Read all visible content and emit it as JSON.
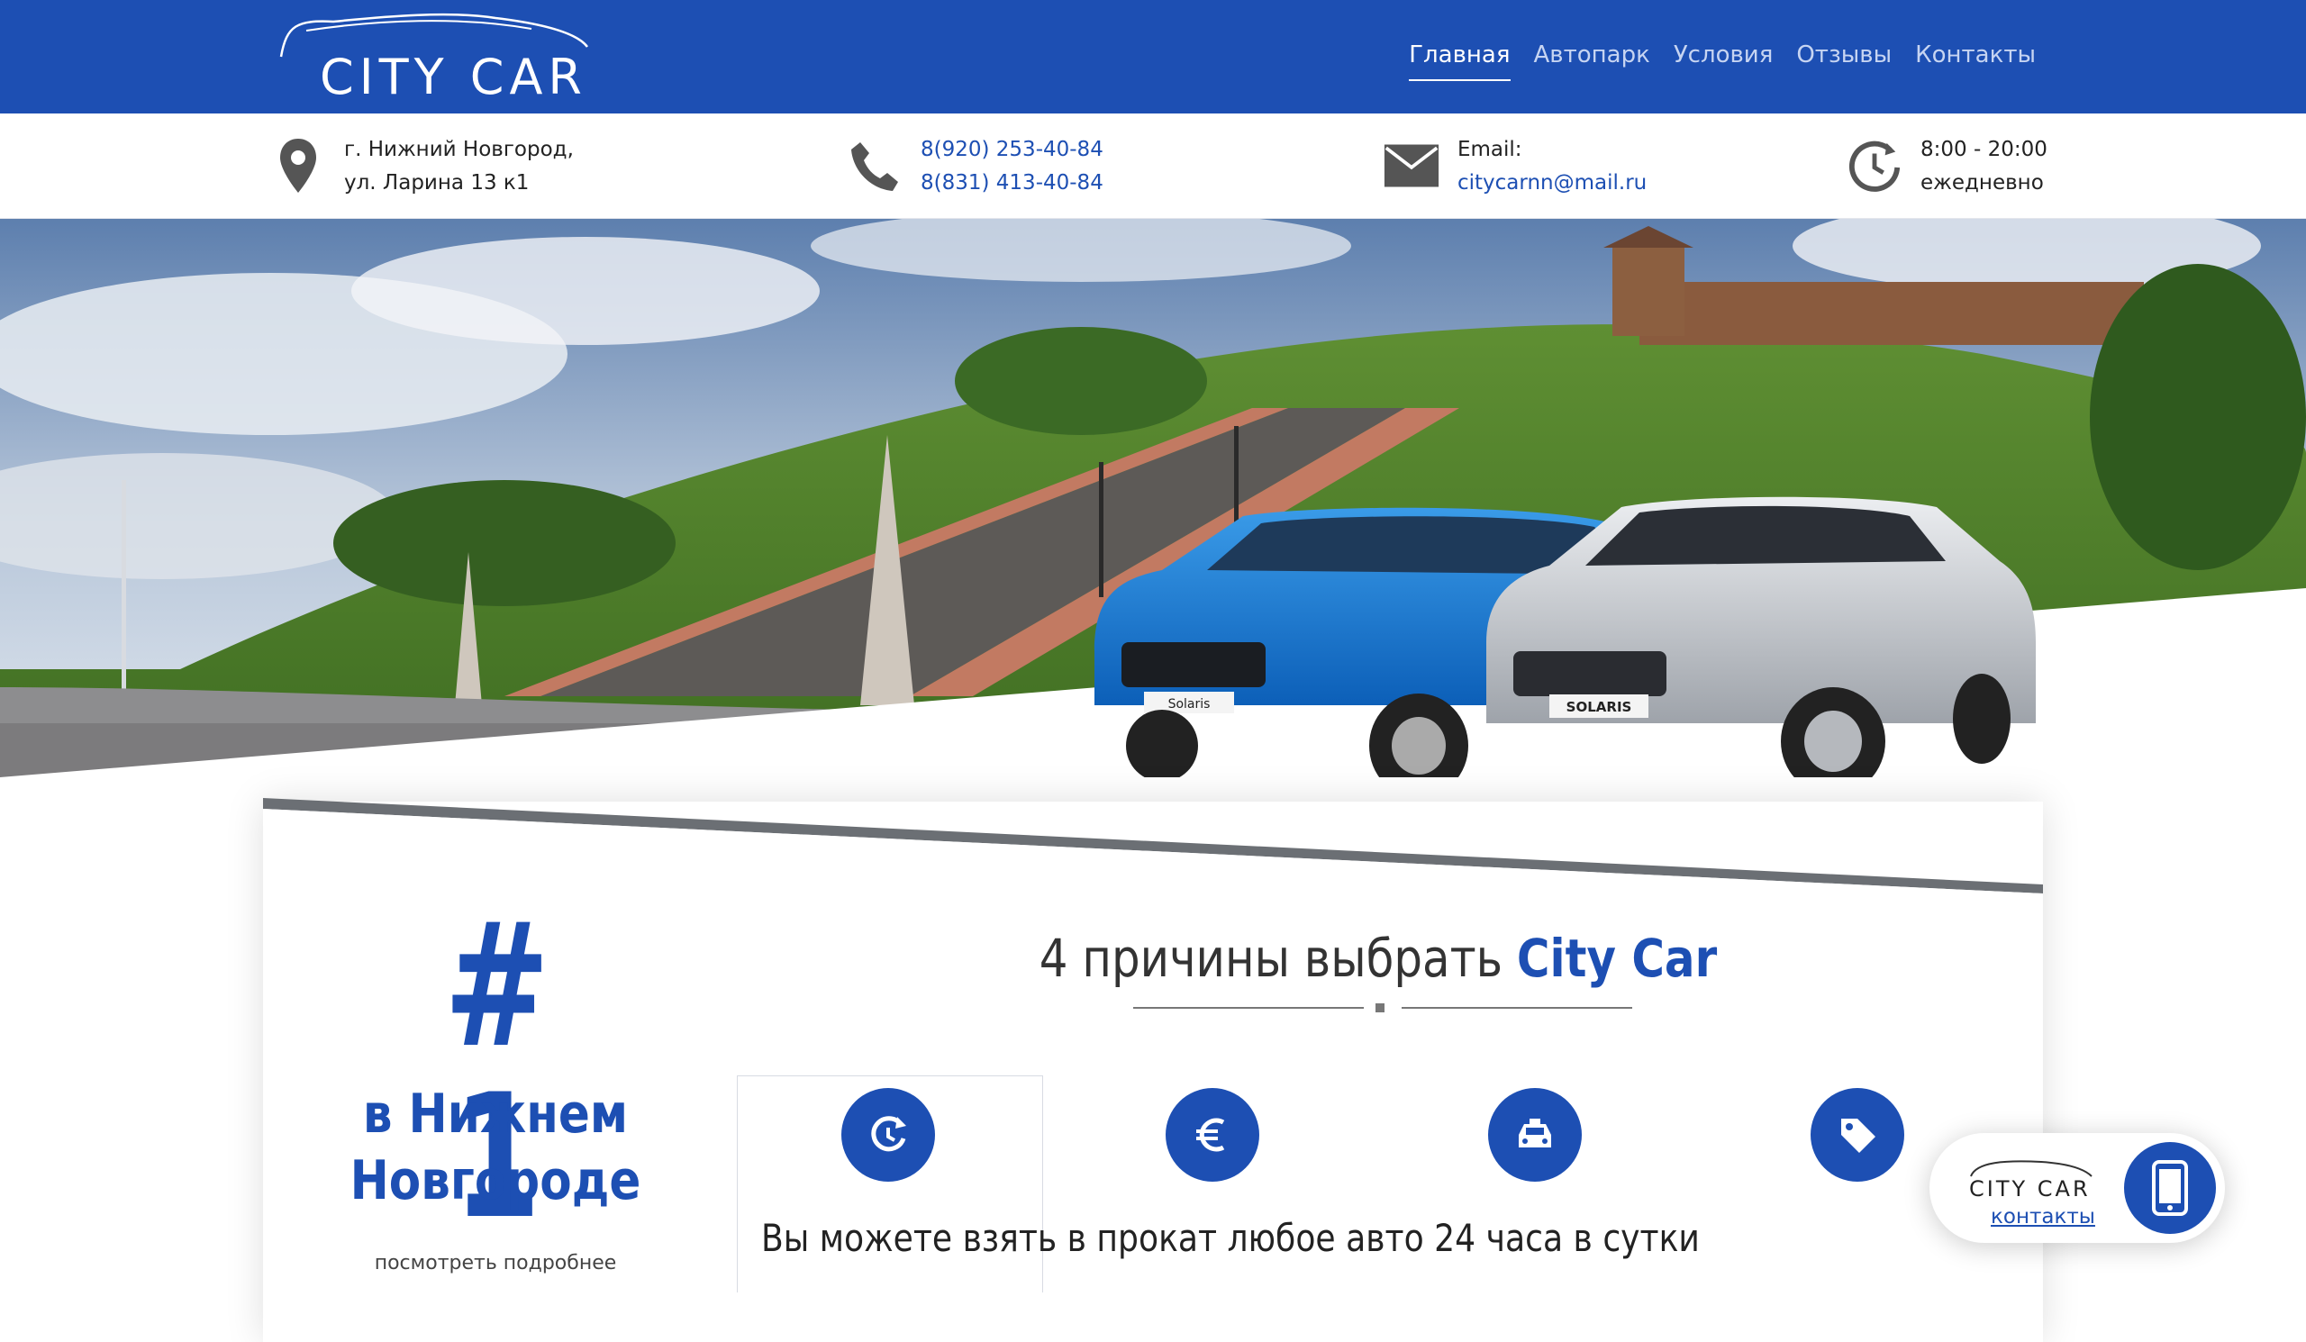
{
  "header": {
    "logo_text": "CITY CAR",
    "nav": [
      {
        "label": "Главная",
        "active": true
      },
      {
        "label": "Автопарк",
        "active": false
      },
      {
        "label": "Условия",
        "active": false
      },
      {
        "label": "Отзывы",
        "active": false
      },
      {
        "label": "Контакты",
        "active": false
      }
    ]
  },
  "contacts": {
    "address_line1": "г. Нижний Новгород,",
    "address_line2": "ул. Ларина 13 к1",
    "phone1": "8(920) 253-40-84",
    "phone2": "8(831) 413-40-84",
    "email_label": "Email:",
    "email": "citycarnn@mail.ru",
    "hours_line1": "8:00 - 20:00",
    "hours_line2": "ежедневно"
  },
  "hero": {
    "car_badge_1": "Solaris",
    "car_badge_2": "SOLARIS"
  },
  "rank": {
    "number": "# 1",
    "city_line1": "в Нижнем",
    "city_line2": "Новгороде",
    "more_link": "посмотреть подробнее"
  },
  "reasons": {
    "title_prefix": "4 причины выбрать",
    "title_brand": "City Car",
    "features": [
      {
        "icon": "clock-refresh-icon"
      },
      {
        "icon": "euro-icon"
      },
      {
        "icon": "taxi-car-icon"
      },
      {
        "icon": "price-tag-icon"
      }
    ],
    "active_text": "Вы можете взять в прокат любое авто 24 часа в сутки"
  },
  "widget": {
    "logo_text": "CITY CAR",
    "link": "контакты"
  },
  "colors": {
    "brand_blue": "#1d4fb3",
    "header_bg": "#1d4fb3",
    "link_blue": "#1d4fb3"
  }
}
